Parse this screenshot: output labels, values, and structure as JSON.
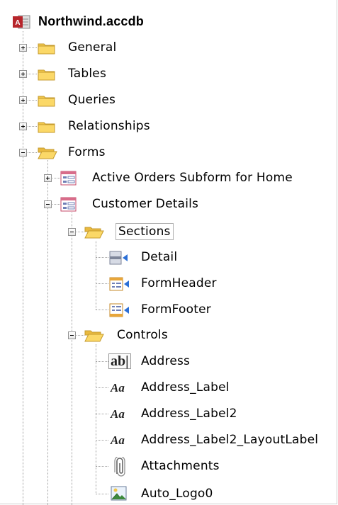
{
  "root": {
    "label": "Northwind.accdb",
    "icon": "access-database-icon"
  },
  "top_level": [
    {
      "label": "General",
      "expanded": false,
      "icon": "folder-closed-icon"
    },
    {
      "label": "Tables",
      "expanded": false,
      "icon": "folder-closed-icon"
    },
    {
      "label": "Queries",
      "expanded": false,
      "icon": "folder-closed-icon"
    },
    {
      "label": "Relationships",
      "expanded": false,
      "icon": "folder-closed-icon"
    },
    {
      "label": "Forms",
      "expanded": true,
      "icon": "folder-open-icon"
    }
  ],
  "forms": [
    {
      "label": "Active Orders Subform for Home",
      "expanded": false,
      "icon": "form-icon"
    },
    {
      "label": "Customer Details",
      "expanded": true,
      "icon": "form-icon"
    }
  ],
  "customer_details": {
    "sections": {
      "label": "Sections",
      "expanded": true,
      "selected": true,
      "icon": "folder-open-icon",
      "items": [
        {
          "label": "Detail",
          "icon": "section-detail-icon"
        },
        {
          "label": "FormHeader",
          "icon": "section-header-icon"
        },
        {
          "label": "FormFooter",
          "icon": "section-footer-icon"
        }
      ]
    },
    "controls": {
      "label": "Controls",
      "expanded": true,
      "icon": "folder-open-icon",
      "items": [
        {
          "label": "Address",
          "icon": "textbox-icon",
          "glyph": "ab|"
        },
        {
          "label": "Address_Label",
          "icon": "label-icon",
          "glyph": "Aa"
        },
        {
          "label": "Address_Label2",
          "icon": "label-icon",
          "glyph": "Aa"
        },
        {
          "label": "Address_Label2_LayoutLabel",
          "icon": "label-icon",
          "glyph": "Aa"
        },
        {
          "label": "Attachments",
          "icon": "attachment-icon"
        },
        {
          "label": "Auto_Logo0",
          "icon": "image-icon"
        }
      ]
    }
  }
}
